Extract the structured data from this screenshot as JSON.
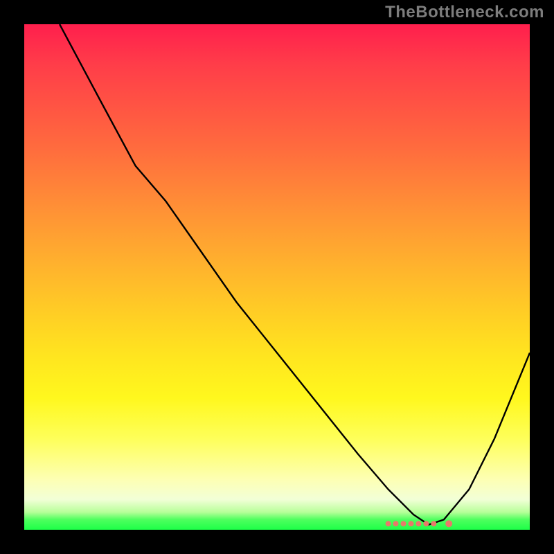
{
  "watermark": "TheBottleneck.com",
  "chart_data": {
    "type": "line",
    "title": "",
    "xlabel": "",
    "ylabel": "",
    "xlim": [
      0,
      100
    ],
    "ylim": [
      0,
      100
    ],
    "grid": false,
    "legend": false,
    "series": [
      {
        "name": "curve",
        "x": [
          7,
          15,
          22,
          28,
          35,
          42,
          50,
          58,
          66,
          72,
          77,
          80,
          83,
          88,
          93,
          100
        ],
        "y": [
          100,
          85,
          72,
          65,
          55,
          45,
          35,
          25,
          15,
          8,
          3,
          1,
          2,
          8,
          18,
          35
        ]
      }
    ],
    "markers": {
      "name": "min-band-dots",
      "color": "#e8796a",
      "points": [
        {
          "x": 72,
          "y": 1.2
        },
        {
          "x": 73.5,
          "y": 1.2
        },
        {
          "x": 75,
          "y": 1.2
        },
        {
          "x": 76.5,
          "y": 1.2
        },
        {
          "x": 78,
          "y": 1.2
        },
        {
          "x": 79.5,
          "y": 1.2
        },
        {
          "x": 81,
          "y": 1.2
        },
        {
          "x": 84,
          "y": 1.2
        }
      ]
    },
    "gradient_stops": [
      {
        "pos": 0,
        "color": "#ff1f4d"
      },
      {
        "pos": 24,
        "color": "#ff6a3e"
      },
      {
        "pos": 48,
        "color": "#ffb32d"
      },
      {
        "pos": 74,
        "color": "#fff81e"
      },
      {
        "pos": 94,
        "color": "#f2ffd7"
      },
      {
        "pos": 100,
        "color": "#1dff48"
      }
    ]
  }
}
